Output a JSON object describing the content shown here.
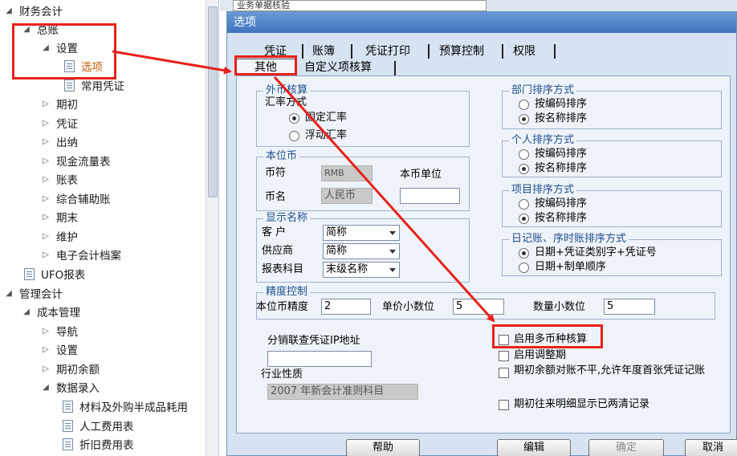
{
  "tree": {
    "items": [
      {
        "label": "财务会计",
        "arrow": "◢"
      },
      {
        "label": "总账",
        "arrow": "◢"
      },
      {
        "label": "设置",
        "arrow": "◢"
      },
      {
        "label": "选项"
      },
      {
        "label": "常用凭证"
      },
      {
        "label": "期初",
        "arrow": "▷"
      },
      {
        "label": "凭证",
        "arrow": "▷"
      },
      {
        "label": "出纳",
        "arrow": "▷"
      },
      {
        "label": "现金流量表",
        "arrow": "▷"
      },
      {
        "label": "账表",
        "arrow": "▷"
      },
      {
        "label": "综合辅助账",
        "arrow": "▷"
      },
      {
        "label": "期末",
        "arrow": "▷"
      },
      {
        "label": "维护",
        "arrow": "▷"
      },
      {
        "label": "电子会计档案",
        "arrow": "▷"
      },
      {
        "label": "UFO报表"
      },
      {
        "label": "管理会计",
        "arrow": "◢"
      },
      {
        "label": "成本管理",
        "arrow": "◢"
      },
      {
        "label": "导航",
        "arrow": "▷"
      },
      {
        "label": "设置",
        "arrow": "▷"
      },
      {
        "label": "期初余额",
        "arrow": "▷"
      },
      {
        "label": "数据录入",
        "arrow": "◢"
      },
      {
        "label": "材料及外购半成品耗用"
      },
      {
        "label": "人工费用表"
      },
      {
        "label": "折旧费用表"
      }
    ]
  },
  "background_field": "业务单据核验",
  "dialog": {
    "title": "选项",
    "tabs_row1": [
      "凭证",
      "账簿",
      "凭证打印",
      "预算控制",
      "权限"
    ],
    "tabs_row2": [
      "其他",
      "自定义项核算"
    ],
    "waibi": {
      "title": "外币核算",
      "rate_label": "汇率方式",
      "options": [
        "固定汇率",
        "浮动汇率"
      ]
    },
    "benweibi": {
      "title": "本位币",
      "symbol_label": "币符",
      "symbol_value": "RMB",
      "unit_label": "本币单位",
      "unit_value": "",
      "name_label": "币名",
      "name_value": "人民币"
    },
    "display": {
      "title": "显示名称",
      "rows": [
        {
          "label": "客 户",
          "value": "简称"
        },
        {
          "label": "供应商",
          "value": "简称"
        },
        {
          "label": "报表科目",
          "value": "末级名称"
        }
      ]
    },
    "precision": {
      "title": "精度控制",
      "base_label": "本位币精度",
      "base_value": "2",
      "price_label": "单价小数位",
      "price_value": "5",
      "qty_label": "数量小数位",
      "qty_value": "5"
    },
    "ip_label": "分销联查凭证IP地址",
    "ip_value": "",
    "industry_label": "行业性质",
    "industry_value": "2007 年新会计准则科目",
    "dept_sort": {
      "title": "部门排序方式",
      "options": [
        "按编码排序",
        "按名称排序"
      ]
    },
    "person_sort": {
      "title": "个人排序方式",
      "options": [
        "按编码排序",
        "按名称排序"
      ]
    },
    "project_sort": {
      "title": "项目排序方式",
      "options": [
        "按编码排序",
        "按名称排序"
      ]
    },
    "journal_sort": {
      "title": "日记账、序时账排序方式",
      "options": [
        "日期+凭证类别字+凭证号",
        "日期+制单顺序"
      ]
    },
    "checkboxes": [
      "启用多币种核算",
      "启用调整期",
      "期初余额对账不平,允许年度首张凭证记账",
      "期初往来明细显示已两清记录"
    ],
    "buttons": {
      "help": "帮助",
      "edit": "编辑",
      "ok": "确定",
      "cancel": "取消"
    }
  },
  "colors": {
    "annotation_red": "#e8201b",
    "title_blue": "#3f73bb",
    "group_title": "#1f4e8e",
    "selected_item": "#c25d00"
  }
}
